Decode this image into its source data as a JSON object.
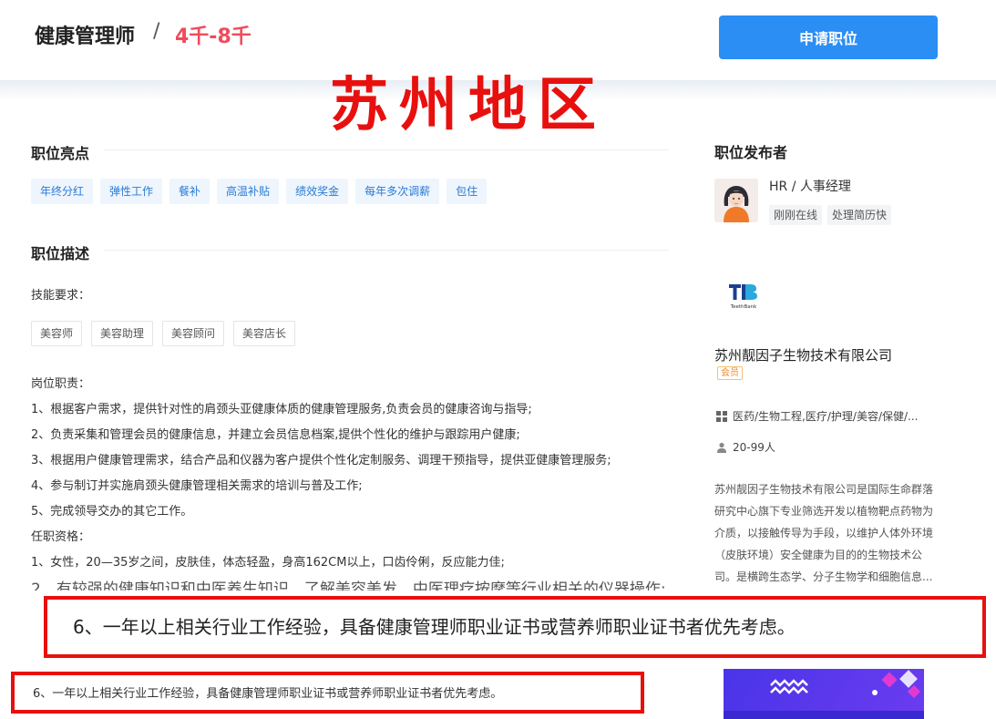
{
  "header": {
    "job_title": "健康管理师",
    "separator": "/",
    "salary": "4千-8千",
    "apply_label": "申请职位"
  },
  "overlay": {
    "region": "苏州地区"
  },
  "highlights": {
    "title": "职位亮点",
    "tags": [
      "年终分红",
      "弹性工作",
      "餐补",
      "高温补贴",
      "绩效奖金",
      "每年多次调薪",
      "包住"
    ]
  },
  "description": {
    "title": "职位描述",
    "skills_label": "技能要求：",
    "skills": [
      "美容师",
      "美容助理",
      "美容顾问",
      "美容店长"
    ],
    "lines": [
      "岗位职责：",
      "1、根据客户需求，提供针对性的肩颈头亚健康体质的健康管理服务,负责会员的健康咨询与指导;",
      "2、负责采集和管理会员的健康信息，并建立会员信息档案,提供个性化的维护与跟踪用户健康;",
      "3、根据用户健康管理需求，结合产品和仪器为客户提供个性化定制服务、调理干预指导，提供亚健康管理服务;",
      "4、参与制订并实施肩颈头健康管理相关需求的培训与普及工作;",
      "5、完成领导交办的其它工作。",
      "任职资格：",
      "1、女性，20—35岁之间，皮肤佳，体态轻盈，身高162CM以上，口齿伶俐，反应能力佳;"
    ],
    "cut_line": "2、有较强的健康知识和中医养生知识，了解美容美发、中医理疗按摩等行业相关的仪器操作;",
    "enlarged_line": "6、一年以上相关行业工作经验，具备健康管理师职业证书或营养师职业证书者优先考虑。",
    "original_line": "6、一年以上相关行业工作经验，具备健康管理师职业证书或营养师职业证书者优先考虑。"
  },
  "publisher": {
    "title": "职位发布者",
    "name_role": "HR / 人事经理",
    "tags": [
      "刚刚在线",
      "处理简历快"
    ]
  },
  "company": {
    "logo_text": "TeethBank",
    "name": "苏州靓因子生物技术有限公司",
    "badge": "会员",
    "industry": "医药/生物工程,医疗/护理/美容/保健/...",
    "size": "20-99人",
    "description": "苏州靓因子生物技术有限公司是国际生命群落研究中心旗下专业筛选开发以植物靶点药物为介质，以接触传导为手段，以维护人体外环境（皮肤环境）安全健康为目的的生物技术公司。是横跨生态学、分子生物学和细胞信息..."
  },
  "colors": {
    "accent": "#2a8ef5",
    "salary": "#f04b5a",
    "annotation_red": "#e8100e",
    "tag_blue": "#2a7bd5"
  },
  "icons": {
    "industry": "grid-icon",
    "size": "person-icon"
  }
}
